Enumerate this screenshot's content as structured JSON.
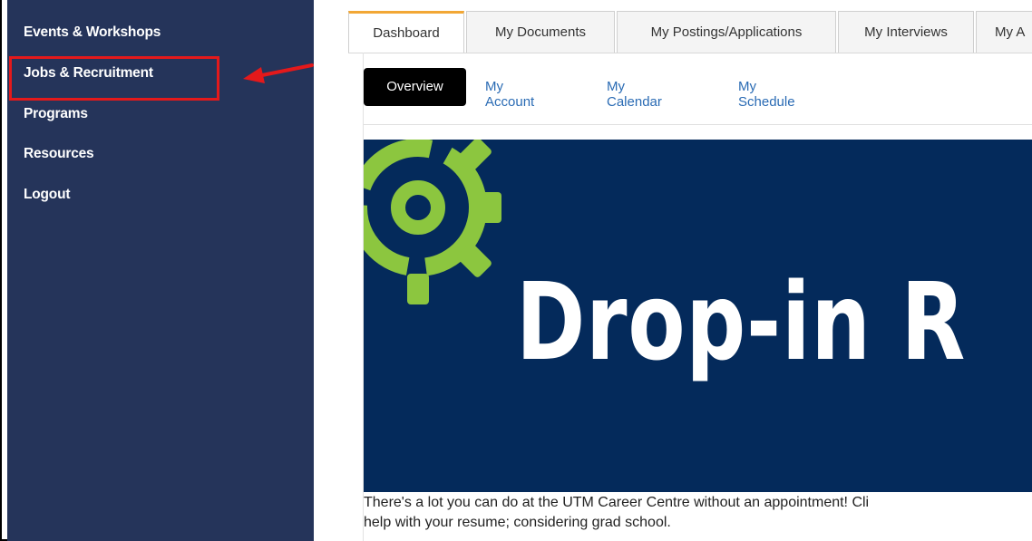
{
  "sidebar": {
    "items": [
      {
        "label": "Events & Workshops"
      },
      {
        "label": "Jobs & Recruitment"
      },
      {
        "label": "Programs"
      },
      {
        "label": "Resources"
      },
      {
        "label": "Logout"
      }
    ]
  },
  "tabs": [
    {
      "label": "Dashboard"
    },
    {
      "label": "My Documents"
    },
    {
      "label": "My Postings/Applications"
    },
    {
      "label": "My Interviews"
    },
    {
      "label": "My A"
    }
  ],
  "subnav": [
    {
      "label": "Overview"
    },
    {
      "label": "My Account"
    },
    {
      "label": "My Calendar"
    },
    {
      "label": "My Schedule"
    }
  ],
  "banner": {
    "title": "Drop-in R",
    "icon": "gear-icon"
  },
  "description": {
    "line1": "There's a lot you can do at the UTM Career Centre without an appointment! Cli",
    "line2": "help with your resume; considering grad school."
  },
  "colors": {
    "sidebar_bg": "#25345a",
    "highlight": "#e4191b",
    "banner_bg": "#042a5b",
    "gear": "#8cc63f",
    "link": "#2a6bb4",
    "active_tab_accent": "#f2a735"
  }
}
